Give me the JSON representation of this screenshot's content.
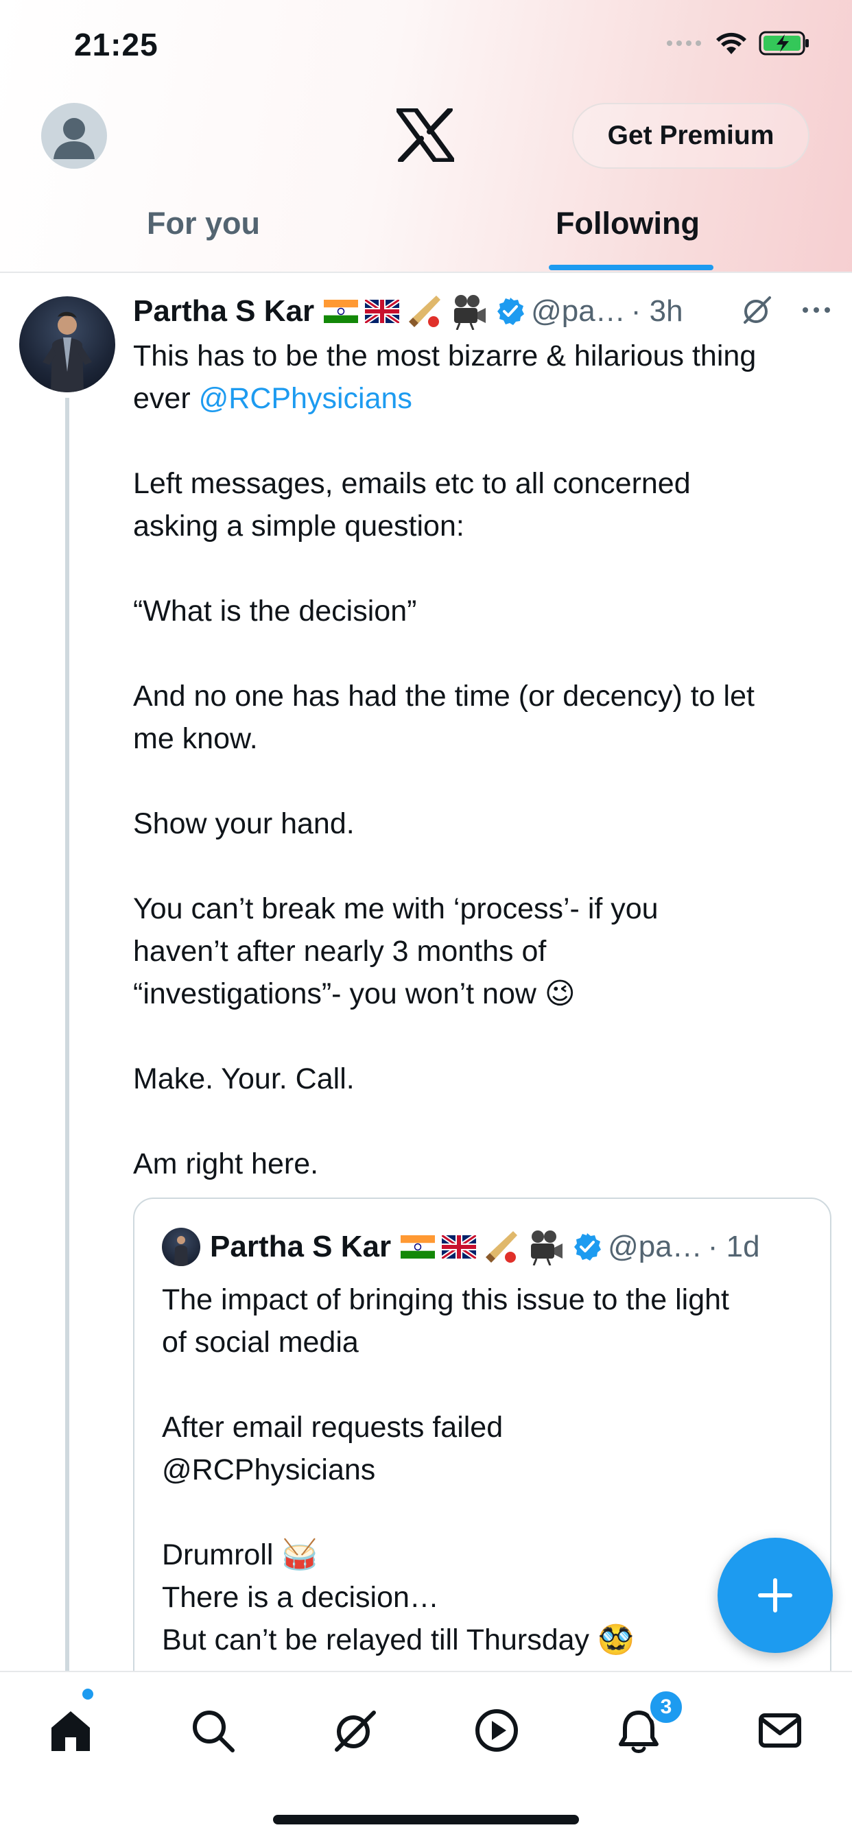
{
  "status_bar": {
    "time": "21:25"
  },
  "header": {
    "premium_label": "Get Premium"
  },
  "tabs": [
    {
      "label": "For you",
      "active": false
    },
    {
      "label": "Following",
      "active": true
    }
  ],
  "tweet": {
    "author_name": "Partha S Kar",
    "handle": "@pa…",
    "time": "· 3h",
    "lines": [
      "This has to be the most bizarre & hilarious thing",
      "ever ",
      "@RCPhysicians",
      "Left messages, emails etc to all concerned",
      "asking a simple question:",
      "“What is the decision”",
      "And no one has had the time (or decency) to let",
      "me know.",
      "Show your hand.",
      "You can’t break me with ‘process’- if you",
      "haven’t after nearly 3 months of",
      "“investigations”- you won’t now 😉",
      "Make. Your. Call.",
      "Am right here."
    ]
  },
  "quote": {
    "author_name": "Partha S Kar",
    "handle": "@pa…",
    "time": "· 1d",
    "lines": [
      "The impact of bringing this issue to the light",
      "of social media",
      "After email requests failed",
      "@RCPhysicians",
      "Drumroll 🥁",
      "There is a decision…",
      "But can’t be relayed till Thursday 🥸"
    ]
  },
  "bottom_nav": {
    "items": [
      "home-icon",
      "search-icon",
      "grok-icon",
      "video-icon",
      "notifications-icon",
      "messages-icon"
    ],
    "notification_count": "3"
  },
  "colors": {
    "accent": "#1d9bf0",
    "text": "#0f1419",
    "muted": "#536471"
  }
}
